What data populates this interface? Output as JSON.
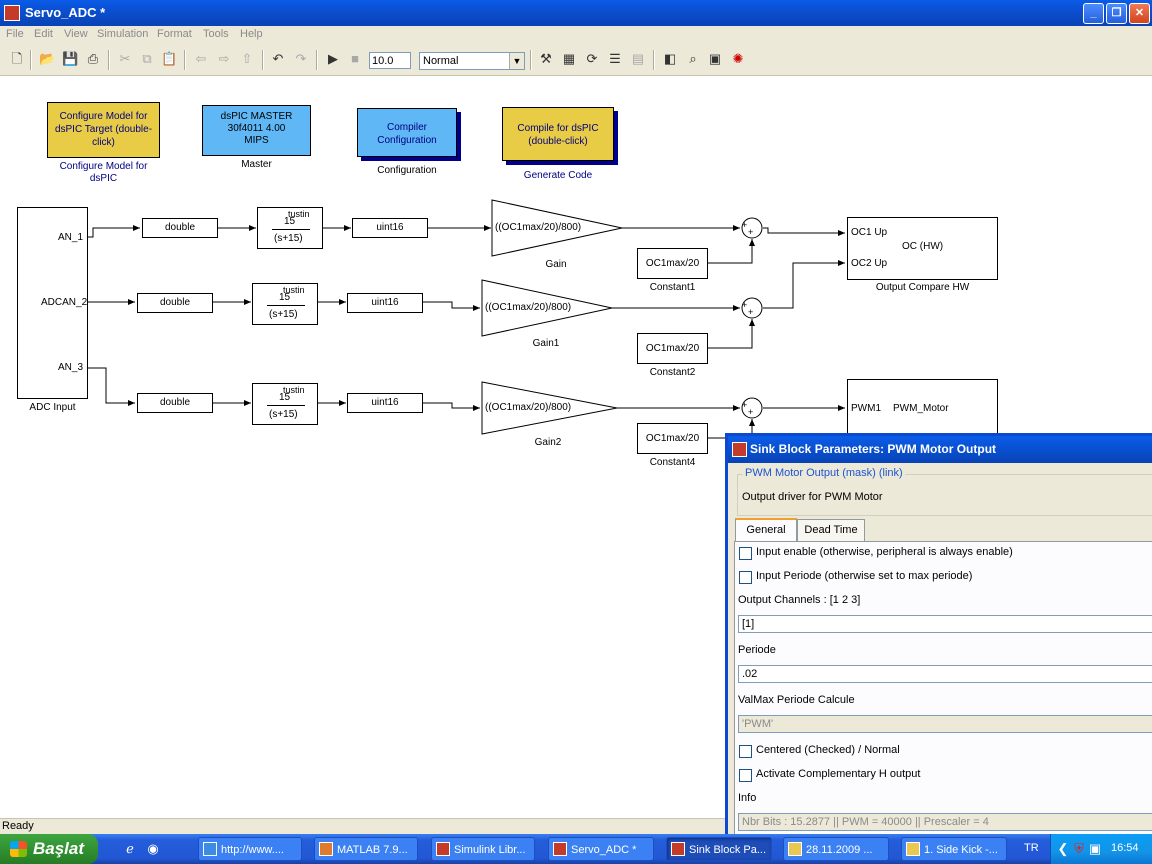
{
  "window": {
    "title": "Servo_ADC *"
  },
  "menu": [
    "File",
    "Edit",
    "View",
    "Simulation",
    "Format",
    "Tools",
    "Help"
  ],
  "toolbar": {
    "stop_time": "10.0",
    "sim_mode": "Normal"
  },
  "top_blocks": [
    {
      "text": "Configure Model for dsPIC Target (double-click)",
      "caption": "Configure Model for dsPIC"
    },
    {
      "text": "dsPIC MASTER 30f4011 4.00 MIPS",
      "caption": "Master"
    },
    {
      "text": "Compiler Configuration",
      "caption": "Configuration"
    },
    {
      "text": "Compile for dsPIC (double-click)",
      "caption": "Generate Code"
    }
  ],
  "adc": {
    "caption": "ADC Input",
    "ports": [
      "AN_1",
      "ADCAN_2",
      "AN_3"
    ]
  },
  "rows": [
    {
      "convert": "double",
      "tf_num": "15",
      "tf_den": "(s+15)",
      "tf_tag": "tustin",
      "uint": "uint16",
      "gain": "((OC1max/20)/800)",
      "gain_caption": "Gain",
      "const": "OC1max/20",
      "const_caption": "Constant1"
    },
    {
      "convert": "double",
      "tf_num": "15",
      "tf_den": "(s+15)",
      "tf_tag": "tustin",
      "uint": "uint16",
      "gain": "((OC1max/20)/800)",
      "gain_caption": "Gain1",
      "const": "OC1max/20",
      "const_caption": "Constant2"
    },
    {
      "convert": "double",
      "tf_num": "15",
      "tf_den": "(s+15)",
      "tf_tag": "tustin",
      "uint": "uint16",
      "gain": "((OC1max/20)/800)",
      "gain_caption": "Gain2",
      "const": "OC1max/20",
      "const_caption": "Constant4"
    }
  ],
  "sum_signs": [
    "+",
    "+"
  ],
  "oc_block": {
    "port1": "OC1 Up",
    "port2": "OC2 Up",
    "title": "OC (HW)",
    "caption": "Output Compare HW"
  },
  "pwm_block": {
    "port": "PWM1",
    "title": "PWM_Motor"
  },
  "status": "Ready",
  "dialog": {
    "title": "Sink Block Parameters: PWM Motor Output",
    "group_legend": "PWM Motor Output (mask) (link)",
    "description": "Output driver for PWM Motor",
    "tabs": [
      "General",
      "Dead Time"
    ],
    "checkbox_input_enable": "Input enable (otherwise, peripheral is always enable)",
    "checkbox_input_periode": "Input Periode (otherwise set to  max periode)",
    "channels_label": "Output Channels : [1  2  3]",
    "channels_value": "[1]",
    "periode_label": "Periode",
    "periode_value": ".02",
    "valmax_label": "ValMax Periode Calcule",
    "valmax_value": "'PWM'",
    "checkbox_centered": "Centered (Checked) / Normal",
    "checkbox_complementary": "Activate Complementary H output",
    "info_label": "Info",
    "info_value": "Nbr Bits : 15.2877  ||  PWM = 40000  ||  Prescaler = 4"
  },
  "taskbar": {
    "start": "Başlat",
    "tasks": [
      "http://www....",
      "MATLAB  7.9...",
      "Simulink Libr...",
      "Servo_ADC *",
      "Sink Block Pa...",
      "28.11.2009 ...",
      "1. Side Kick -..."
    ],
    "lang": "TR",
    "clock": "16:54"
  }
}
